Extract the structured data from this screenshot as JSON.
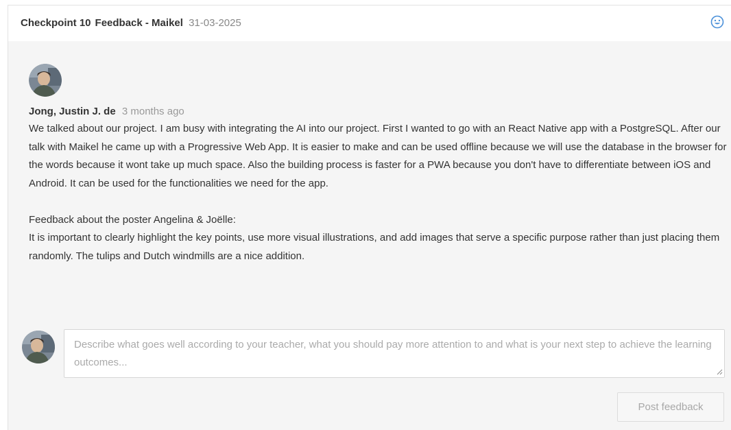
{
  "header": {
    "title_part1": "Checkpoint 10",
    "title_part2": "Feedback - Maikel",
    "date": "31-03-2025",
    "reaction_icon": "smiley-icon",
    "accent_color": "#4a90d9"
  },
  "comment": {
    "author": "Jong, Justin J. de",
    "time": "3 months ago",
    "paragraph1": "We talked about our project. I am busy with integrating the AI into our project. First I wanted to go with an React Native app with a PostgreSQL. After our talk with Maikel he came up with a Progressive Web App. It is easier to make and can be used offline because we will use the database in the browser for the words because it wont take up much space. Also the building process is faster for a PWA because you don't have to differentiate between iOS and Android. It can be used for the functionalities we need for the app.",
    "paragraph2_heading": "Feedback about the poster Angelina & Joëlle:",
    "paragraph2": "It is important to clearly highlight the key points, use more visual illustrations, and add images that serve a specific purpose rather than just placing them randomly. The tulips and Dutch windmills are a nice addition."
  },
  "reply": {
    "placeholder": "Describe what goes well according to your teacher, what you should pay more attention to and what is your next step to achieve the learning outcomes...",
    "value": "",
    "post_label": "Post feedback"
  }
}
